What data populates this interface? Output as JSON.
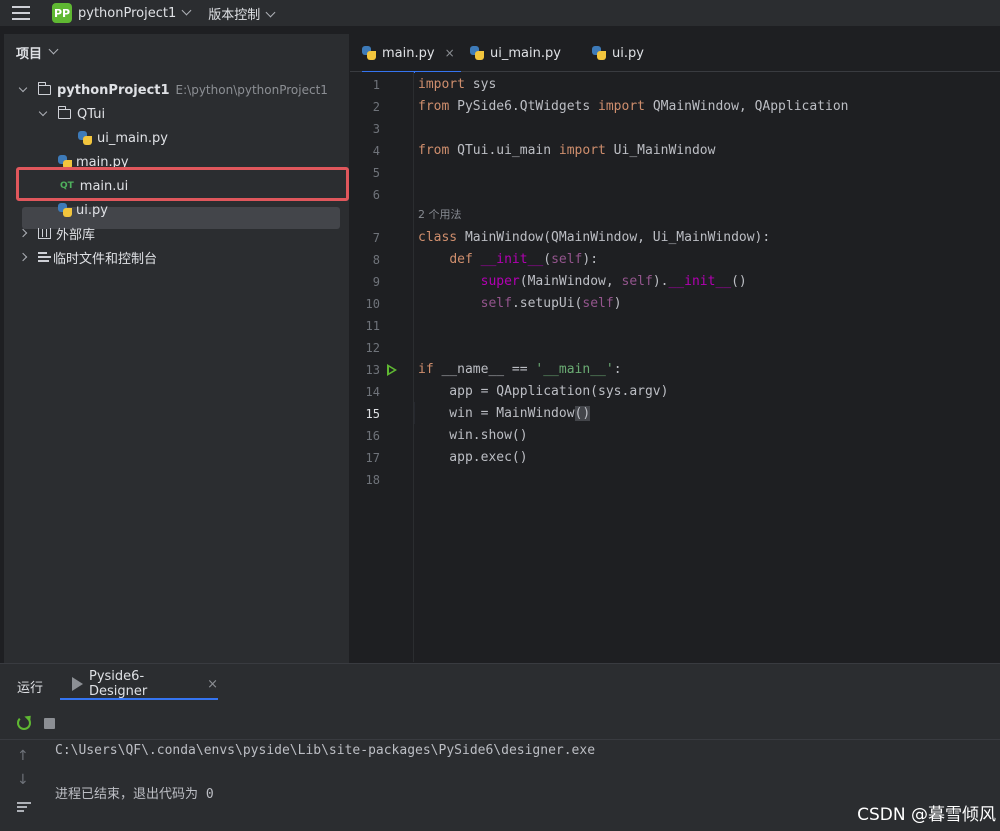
{
  "topbar": {
    "project_badge": "PP",
    "project_name": "pythonProject1",
    "vcs_label": "版本控制"
  },
  "project_panel": {
    "title": "项目",
    "tree": [
      {
        "label": "pythonProject1",
        "path": "E:\\python\\pythonProject1"
      },
      {
        "label": "QTui"
      },
      {
        "label": "ui_main.py"
      },
      {
        "label": "main.py"
      },
      {
        "label": "main.ui",
        "icon_text": "QT"
      },
      {
        "label": "ui.py"
      },
      {
        "label": "外部库"
      },
      {
        "label": "临时文件和控制台"
      }
    ]
  },
  "editor": {
    "tabs": [
      {
        "label": "main.py",
        "close": "×"
      },
      {
        "label": "ui_main.py"
      },
      {
        "label": "ui.py"
      }
    ],
    "line_numbers": [
      "1",
      "2",
      "3",
      "4",
      "5",
      "6",
      "7",
      "8",
      "9",
      "10",
      "11",
      "12",
      "13",
      "14",
      "15",
      "16",
      "17",
      "18"
    ],
    "usage_hint": "2 个用法",
    "current_line": "15"
  },
  "run_panel": {
    "title": "运行",
    "tab_label": "Pyside6-Designer",
    "tab_close": "×",
    "console_lines": [
      "C:\\Users\\QF\\.conda\\envs\\pyside\\Lib\\site-packages\\PySide6\\designer.exe",
      "进程已结束，退出代码为 0"
    ]
  },
  "watermark": "CSDN @暮雪倾风",
  "colors": {
    "accent": "#3574f0",
    "highlight_box": "#e0575c",
    "keyword": "#cf8e6d",
    "function": "#56a8f5",
    "string": "#6aab73"
  }
}
